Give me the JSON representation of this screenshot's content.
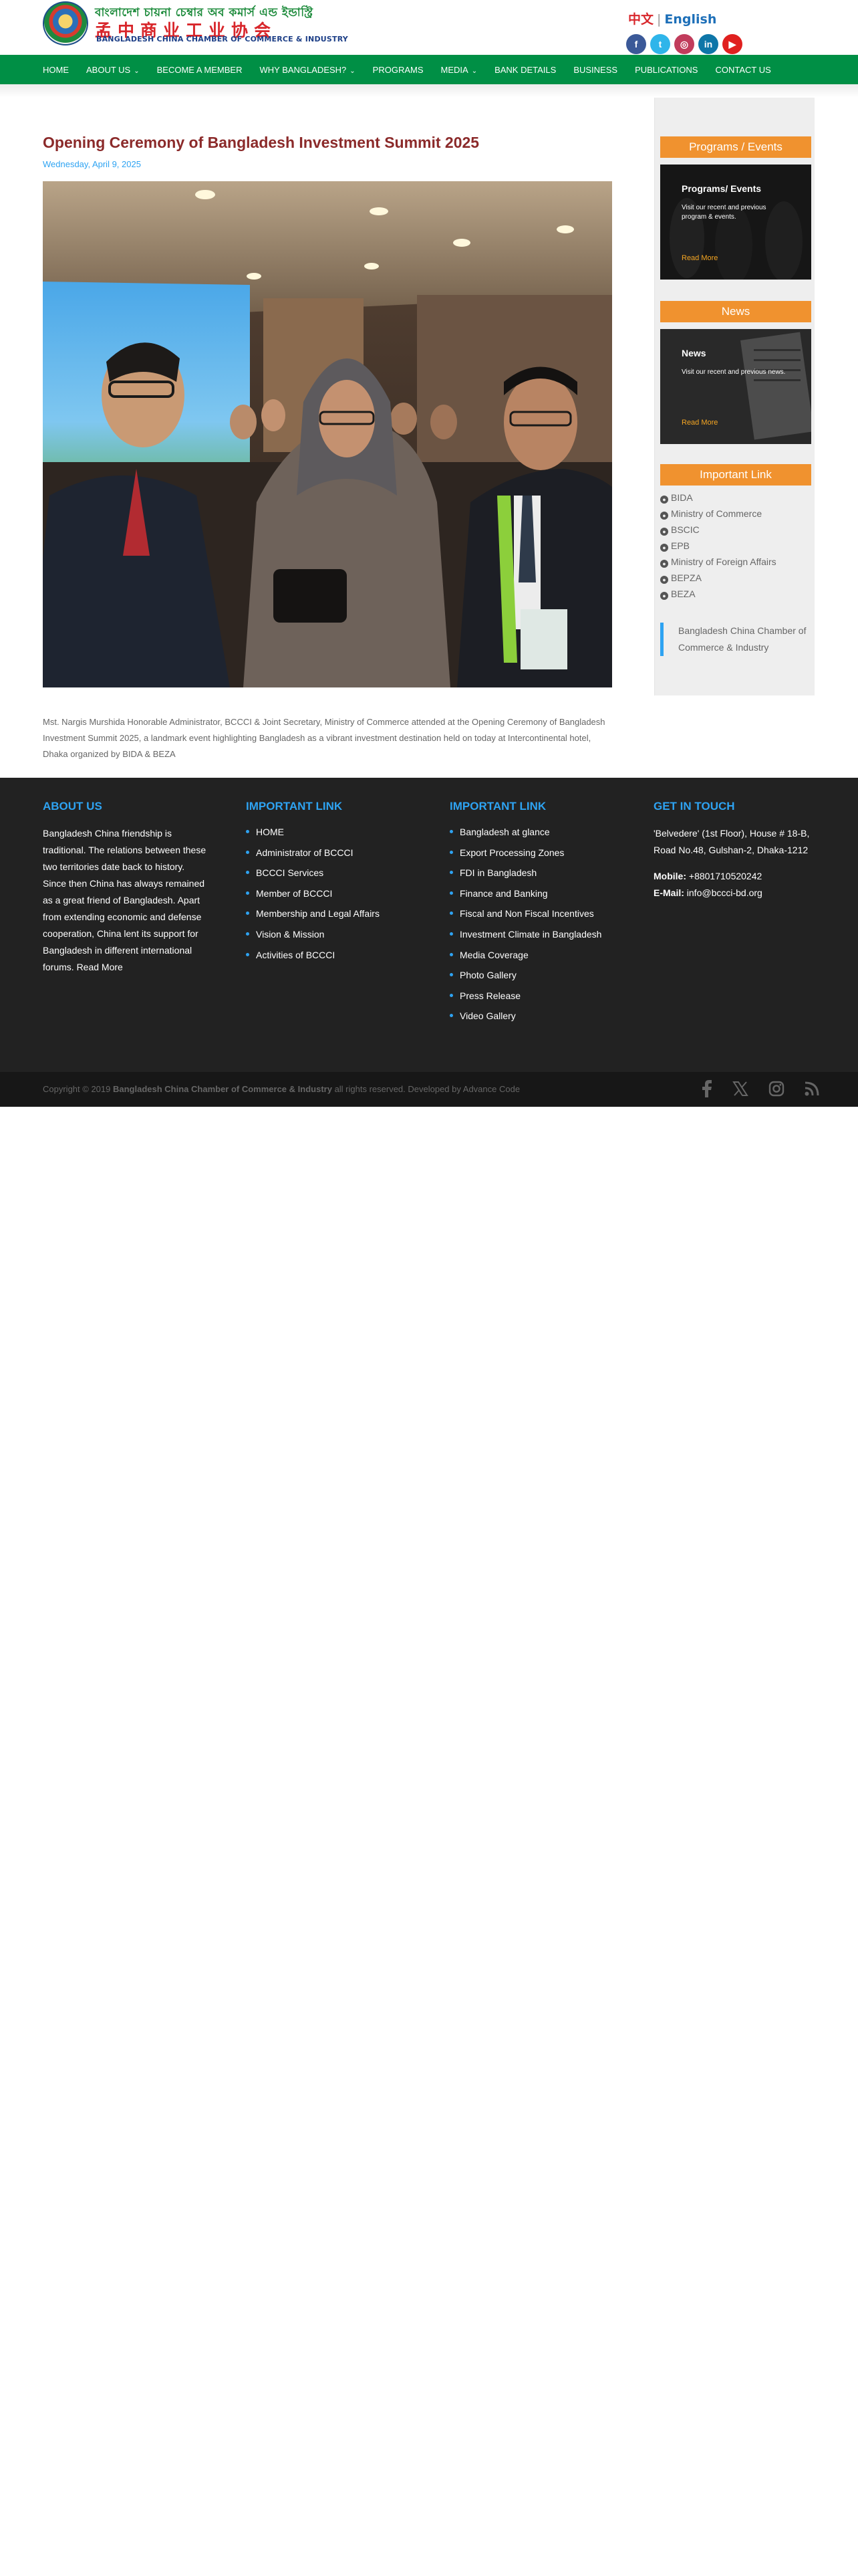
{
  "header": {
    "logo_bn": "বাংলাদেশ চায়না চেম্বার অব কমার্স এন্ড ইন্ডাস্ট্রি",
    "logo_cn": "孟中商业工业协会",
    "logo_en": "BANGLADESH CHINA CHAMBER OF COMMERCE & INDUSTRY",
    "lang_cn": "中文",
    "lang_sep": "|",
    "lang_en": "English",
    "social": [
      {
        "icon": "facebook-icon",
        "glyph": "f",
        "color": "#3b5998"
      },
      {
        "icon": "twitter-icon",
        "glyph": "t",
        "color": "#2fb5ea"
      },
      {
        "icon": "instagram-icon",
        "glyph": "◎",
        "color": "#c13c5c"
      },
      {
        "icon": "linkedin-icon",
        "glyph": "in",
        "color": "#0e76a8"
      },
      {
        "icon": "youtube-icon",
        "glyph": "▶",
        "color": "#e0201f"
      }
    ]
  },
  "nav": {
    "items": [
      {
        "label": "HOME",
        "dropdown": false
      },
      {
        "label": "ABOUT US",
        "dropdown": true
      },
      {
        "label": "BECOME A MEMBER",
        "dropdown": false
      },
      {
        "label": "WHY BANGLADESH?",
        "dropdown": true
      },
      {
        "label": "PROGRAMS",
        "dropdown": false
      },
      {
        "label": "MEDIA",
        "dropdown": true
      },
      {
        "label": "BANK DETAILS",
        "dropdown": false
      },
      {
        "label": "BUSINESS",
        "dropdown": false
      },
      {
        "label": "PUBLICATIONS",
        "dropdown": false
      },
      {
        "label": "CONTACT US",
        "dropdown": false
      }
    ],
    "background": "#008f45"
  },
  "post": {
    "title": "Opening Ceremony of Bangladesh Investment Summit 2025",
    "date": "Wednesday, April 9, 2025",
    "body": "Mst. Nargis Murshida Honorable Administrator, BCCCI & Joint Secretary, Ministry of Commerce attended at the Opening Ceremony of Bangladesh Investment Summit 2025, a landmark event highlighting Bangladesh as a vibrant investment destination held on today at Intercontinental hotel, Dhaka organized by BIDA & BEZA"
  },
  "sidebar": {
    "programs_heading": "Programs / Events",
    "programs_card": {
      "title": "Programs/ Events",
      "subtitle": "Visit our recent and previous program & events.",
      "more": "Read More"
    },
    "news_heading": "News",
    "news_card": {
      "title": "News",
      "subtitle": "Visit our recent and previous news.",
      "more": "Read More"
    },
    "links_heading": "Important Link",
    "links": [
      "BIDA",
      "Ministry of Commerce",
      "BSCIC",
      "EPB",
      "Ministry of Foreign Affairs",
      "BEPZA",
      "BEZA"
    ],
    "quote": "Bangladesh China Chamber of Commerce & Industry"
  },
  "footer": {
    "about": {
      "heading": "ABOUT US",
      "text": "Bangladesh China friendship is traditional. The relations between these two territories date back to history. Since then China has always remained as a great friend of Bangladesh. Apart from extending economic and defense cooperation, China lent its support for Bangladesh in different international forums. Read More"
    },
    "links1": {
      "heading": "IMPORTANT LINK",
      "items": [
        "HOME",
        "Administrator of BCCCI",
        "BCCCI Services",
        "Member of BCCCI",
        "Membership and Legal Affairs",
        "Vision & Mission",
        "Activities of BCCCI"
      ]
    },
    "links2": {
      "heading": "IMPORTANT LINK",
      "items": [
        "Bangladesh at glance",
        "Export Processing Zones",
        "FDI in Bangladesh",
        "Finance and Banking",
        "Fiscal and Non Fiscal Incentives",
        "Investment Climate in Bangladesh",
        "Media Coverage",
        "Photo Gallery",
        "Press Release",
        "Video Gallery"
      ]
    },
    "contact": {
      "heading": "GET IN TOUCH",
      "address": "'Belvedere' (1st Floor), House # 18-B, Road No.48, Gulshan-2, Dhaka-1212",
      "mobile_label": "Mobile:",
      "mobile": "+8801710520242",
      "email_label": "E-Mail:",
      "email": "info@bccci-bd.org"
    }
  },
  "bottom": {
    "copyright_pre": "Copyright © 2019",
    "copyright_org": "Bangladesh China Chamber of Commerce & Industry",
    "copyright_post": "all rights reserved. Developed by Advance Code",
    "icons": [
      "facebook-icon",
      "x-icon",
      "instagram-icon",
      "rss-icon"
    ]
  }
}
